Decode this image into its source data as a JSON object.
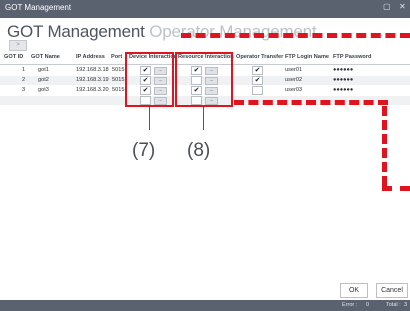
{
  "window": {
    "title": "GOT Management",
    "minimize_glyph": "▢",
    "close_glyph": "✕"
  },
  "heading": {
    "primary": "GOT Management",
    "secondary": "Operator Management"
  },
  "nav": {
    "back_glyph": ">"
  },
  "table": {
    "headers": [
      "GOT ID",
      "GOT Name",
      "IP Address",
      "Port",
      "Device Interaction",
      "Resource Interaction",
      "Operator Transfer",
      "FTP Login Name",
      "FTP Password"
    ],
    "rows": [
      {
        "id": "1",
        "name": "got1",
        "ip": "192.168.3.18",
        "port": "5015",
        "device": true,
        "resource": true,
        "transfer": true,
        "ftp_login": "user01",
        "ftp_password": "●●●●●●"
      },
      {
        "id": "2",
        "name": "got2",
        "ip": "192.168.3.19",
        "port": "5015",
        "device": true,
        "resource": false,
        "transfer": true,
        "ftp_login": "user02",
        "ftp_password": "●●●●●●"
      },
      {
        "id": "3",
        "name": "got3",
        "ip": "192.168.3.20",
        "port": "5015",
        "device": true,
        "resource": true,
        "transfer": false,
        "ftp_login": "user03",
        "ftp_password": "●●●●●●"
      }
    ],
    "check_glyph": "✔",
    "dots_label": "...",
    "colors": {
      "header_rule": "#c8ccd1",
      "alt_row": "#f0f1f3"
    }
  },
  "callouts": {
    "device": "(7)",
    "resource": "(8)",
    "color": "#e0141e"
  },
  "buttons": {
    "ok": "OK",
    "cancel": "Cancel"
  },
  "status": {
    "error_label": "Error :",
    "error_value": "0",
    "total_label": "Total :",
    "total_value": "3"
  }
}
